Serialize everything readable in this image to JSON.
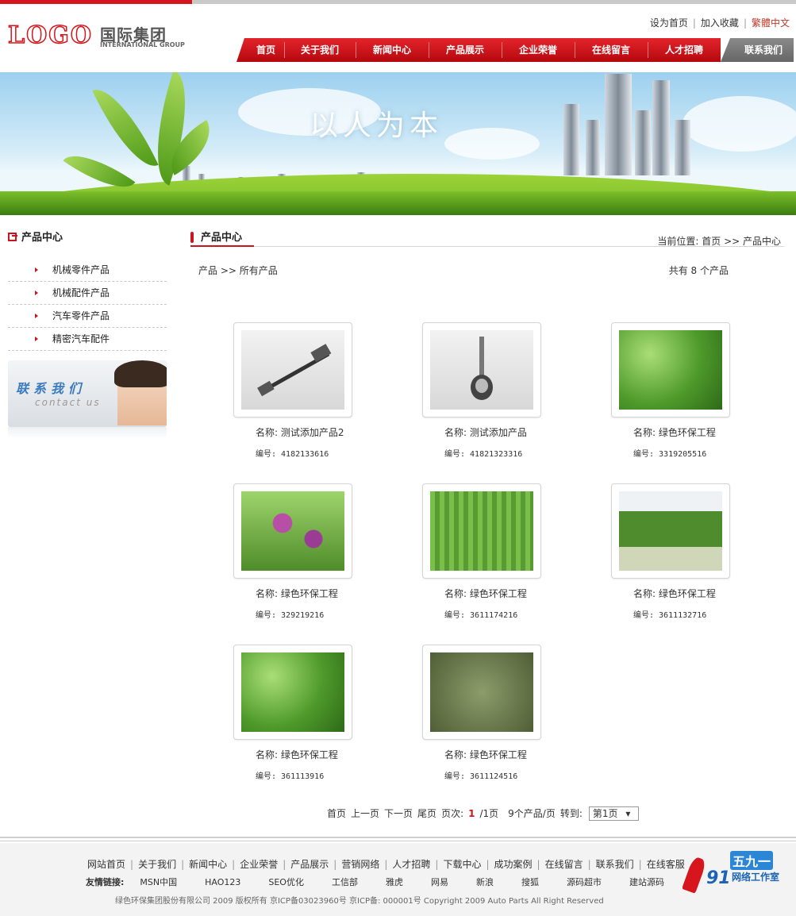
{
  "header": {
    "logo_word": "LOGO",
    "logo_cn": "国际集团",
    "logo_en": "INTERNATIONAL GROUP",
    "top_links": [
      "设为首页",
      "加入收藏",
      "繁體中文"
    ],
    "nav": [
      "首页",
      "关于我们",
      "新闻中心",
      "产品展示",
      "企业荣誉",
      "在线留言",
      "人才招聘",
      "联系我们"
    ]
  },
  "banner": {
    "slogan": "以人为本"
  },
  "sidebar": {
    "title": "产品中心",
    "items": [
      "机械零件产品",
      "机械配件产品",
      "汽车零件产品",
      "精密汽车配件"
    ],
    "contact_cn": "联系我们",
    "contact_en": "contact us"
  },
  "main": {
    "title": "产品中心",
    "position": "当前位置: 首页 >> 产品中心",
    "crumbs": "产品 >> 所有产品",
    "count": "共有 8 个产品",
    "products": [
      {
        "name": "名称: 测试添加产品2",
        "code": "编号: 4182133616",
        "img": "mech-shaft"
      },
      {
        "name": "名称: 测试添加产品",
        "code": "编号: 41821323316",
        "img": "mech-joint"
      },
      {
        "name": "名称: 绿色环保工程",
        "code": "编号: 3319205516",
        "img": "green-leaves"
      },
      {
        "name": "名称: 绿色环保工程",
        "code": "编号: 329219216",
        "img": "purple-flowers"
      },
      {
        "name": "名称: 绿色环保工程",
        "code": "编号: 3611174216",
        "img": "willow-trees"
      },
      {
        "name": "名称: 绿色环保工程",
        "code": "编号: 3611132716",
        "img": "tree-row"
      },
      {
        "name": "名称: 绿色环保工程",
        "code": "编号: 361113916",
        "img": "tree-canopy"
      },
      {
        "name": "名称: 绿色环保工程",
        "code": "编号: 3611124516",
        "img": "vine-leaves"
      }
    ]
  },
  "pager": {
    "first": "首页",
    "prev": "上一页",
    "next": "下一页",
    "last": "尾页",
    "pages_label": "页次:",
    "current": "1",
    "total": "/1页",
    "per_page": "9个产品/页",
    "goto": "转到:",
    "select": "第1页"
  },
  "footer": {
    "nav": [
      "网站首页",
      "关于我们",
      "新闻中心",
      "企业荣誉",
      "产品展示",
      "营销网络",
      "人才招聘",
      "下载中心",
      "成功案例",
      "在线留言",
      "联系我们",
      "在线客服"
    ],
    "friend_label": "友情链接:",
    "friends": [
      "MSN中国",
      "HAO123",
      "SEO优化",
      "工信部",
      "雅虎",
      "网易",
      "新浪",
      "搜狐",
      "源码超市",
      "建站源码"
    ],
    "copyright": "绿色环保集团股份有限公司 2009 版权所有 京ICP备03023960号 京ICP备: 000001号 Copyright 2009 Auto Parts All Right Reserved",
    "badge_num": "91",
    "badge_cn": "五九一",
    "badge_sub": "网络工作室"
  }
}
